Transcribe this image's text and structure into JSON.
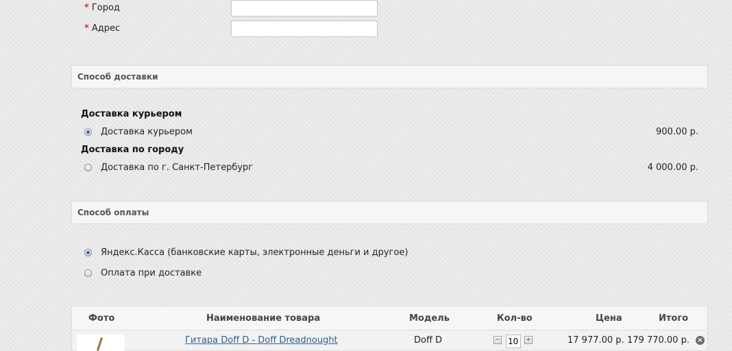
{
  "address_form": {
    "city": {
      "required_mark": "*",
      "label": "Город",
      "value": ""
    },
    "address": {
      "required_mark": "*",
      "label": "Адрес",
      "value": ""
    }
  },
  "delivery": {
    "section_title": "Способ доставки",
    "groups": [
      {
        "title": "Доставка курьером",
        "option": {
          "label": "Доставка курьером",
          "price": "900.00 р.",
          "selected": true
        }
      },
      {
        "title": "Доставка по городу",
        "option": {
          "label": "Доставка по г. Санкт-Петербург",
          "price": "4 000.00 р.",
          "selected": false
        }
      }
    ]
  },
  "payment": {
    "section_title": "Способ оплаты",
    "options": [
      {
        "label": "Яндекс.Касса (банковские карты, электронные деньги и другое)",
        "selected": true
      },
      {
        "label": "Оплата при доставке",
        "selected": false
      }
    ]
  },
  "cart": {
    "columns": {
      "photo": "Фото",
      "name": "Наименование товара",
      "model": "Модель",
      "qty": "Кол-во",
      "price": "Цена",
      "total": "Итого"
    },
    "rows": [
      {
        "name": "Гитара Doff D - Doff Dreadnought",
        "model": "Doff D",
        "qty": "10",
        "price": "17 977.00 р.",
        "total": "179 770.00 р."
      }
    ]
  },
  "icons": {
    "qty_minus": "minus-icon",
    "qty_plus": "plus-icon",
    "remove": "remove-icon"
  },
  "colors": {
    "accent_link": "#2f5e8e",
    "required": "#c0392b",
    "radio_selected": "#2d6aa8"
  }
}
